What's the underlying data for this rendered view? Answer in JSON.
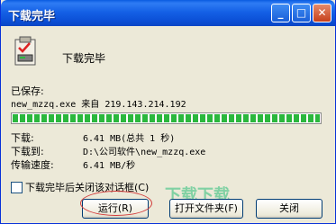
{
  "window": {
    "title": "下载完毕",
    "min_symbol": "_",
    "max_symbol": "□",
    "close_symbol": "✕"
  },
  "heading": "下载完毕",
  "saved": {
    "label": "已保存:",
    "filename": "new_mzzq.exe",
    "from": "来自",
    "ip": "219.143.214.192"
  },
  "progress": {
    "percent": 100
  },
  "info": [
    {
      "label": "下载:",
      "value": "6.41 MB(总共 1 秒)"
    },
    {
      "label": "下载到:",
      "value": "D:\\公司软件\\new_mzzq.exe"
    },
    {
      "label": "传输速度:",
      "value": "6.41 MB/秒"
    }
  ],
  "checkbox": {
    "label": "下载完毕后关闭该对话框(C)",
    "checked": false
  },
  "buttons": {
    "run": "运行(R)",
    "open_folder": "打开文件夹(F)",
    "close": "关闭"
  },
  "watermark": "下载下载",
  "colors": {
    "titlebar": "#0b4fd6",
    "progress": "#2bb73d",
    "highlight_oval": "#d23b3b"
  },
  "icons": {
    "big_icon": "clipboard-download-icon"
  }
}
